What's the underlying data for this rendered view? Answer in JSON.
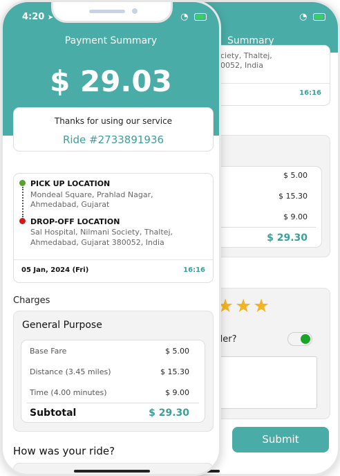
{
  "status": {
    "time": "4:20"
  },
  "header": {
    "title": "Payment Summary",
    "amount": "$ 29.03"
  },
  "thanks": {
    "message": "Thanks for using our service",
    "ride_id": "Ride #2733891936"
  },
  "trip": {
    "pickup_label": "PICK UP LOCATION",
    "pickup_line1": "Mondeal Square, Prahlad Nagar,",
    "pickup_line2": "Ahmedabad, Gujarat",
    "dropoff_label": "DROP-OFF LOCATION",
    "dropoff_line1": "Sal Hospital, Nilmani Society, Thaltej,",
    "dropoff_line2": "Ahmedabad, Gujarat 380052, India",
    "date": "05 Jan, 2024 (Fri)",
    "time": "16:16"
  },
  "charges": {
    "section_title": "Charges",
    "category": "General Purpose",
    "rows": [
      {
        "label": "Base Fare",
        "value": "$ 5.00"
      },
      {
        "label": "Distance (3.45 miles)",
        "value": "$ 15.30"
      },
      {
        "label": "Time (4.00 minutes)",
        "value": "$ 9.00"
      }
    ],
    "subtotal_label": "Subtotal",
    "subtotal_value": "$ 29.30"
  },
  "rating": {
    "question": "How was your ride?",
    "stars": 3
  },
  "back": {
    "header_title_partial": "Summary",
    "addr_line1_partial": "ciety, Thaltej,",
    "addr_line2_partial": "0052, India",
    "time": "16:16",
    "values": [
      "$ 5.00",
      "$ 15.30",
      "$ 9.00"
    ],
    "subtotal_value": "$ 29.30",
    "question_partial": "der?",
    "toggle_on": true,
    "submit_label": "Submit"
  },
  "colors": {
    "accent": "#4aaca7",
    "pickup_dot": "#5ba02e",
    "dropoff_dot": "#d0191c",
    "star": "#f5b321",
    "toggle_on": "#1aa52a"
  }
}
